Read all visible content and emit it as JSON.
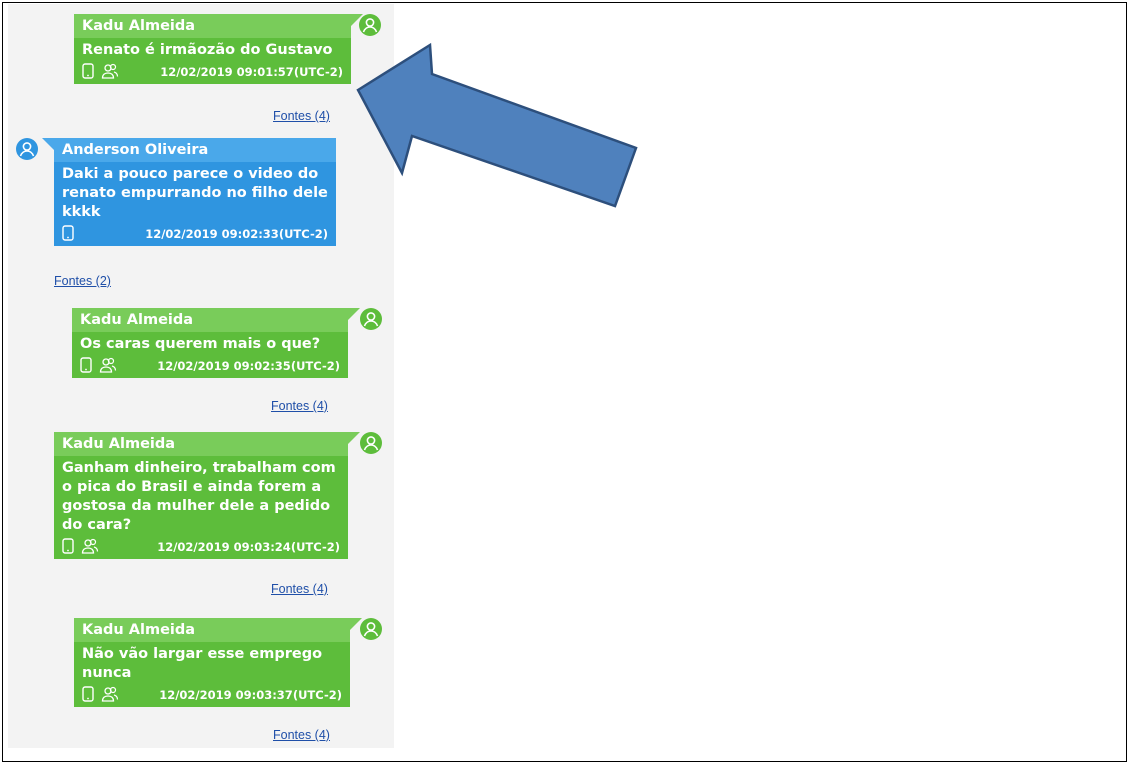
{
  "colors": {
    "green_bubble": "#5dbd3b",
    "green_header": "#79cc5a",
    "blue_bubble": "#2f95e0",
    "blue_header": "#4aa8ea",
    "arrow": "#4f81bd",
    "link": "#1f4fa8"
  },
  "messages": [
    {
      "sender": "Kadu Almeida",
      "text": "Renato é irmãozão do Gustavo",
      "timestamp": "12/02/2019 09:01:57(UTC-2)",
      "sources": "Fontes (4)",
      "direction": "outgoing",
      "icons": [
        "phone-icon",
        "group-icon"
      ]
    },
    {
      "sender": "Anderson Oliveira",
      "text": "Daki a pouco parece o video do renato empurrando no filho dele kkkk",
      "timestamp": "12/02/2019 09:02:33(UTC-2)",
      "sources": "Fontes (2)",
      "direction": "incoming",
      "icons": [
        "phone-icon"
      ]
    },
    {
      "sender": "Kadu Almeida",
      "text": "Os caras querem mais o que?",
      "timestamp": "12/02/2019 09:02:35(UTC-2)",
      "sources": "Fontes (4)",
      "direction": "outgoing",
      "icons": [
        "phone-icon",
        "group-icon"
      ]
    },
    {
      "sender": "Kadu Almeida",
      "text": "Ganham dinheiro, trabalham com o pica do Brasil e ainda forem a gostosa da mulher dele a pedido do cara?",
      "timestamp": "12/02/2019 09:03:24(UTC-2)",
      "sources": "Fontes (4)",
      "direction": "outgoing",
      "icons": [
        "phone-icon",
        "group-icon"
      ]
    },
    {
      "sender": "Kadu Almeida",
      "text": "Não vão largar esse emprego nunca",
      "timestamp": "12/02/2019 09:03:37(UTC-2)",
      "sources": "Fontes (4)",
      "direction": "outgoing",
      "icons": [
        "phone-icon",
        "group-icon"
      ]
    }
  ],
  "annotation": {
    "icon": "arrow-icon",
    "points_to": "first-message"
  }
}
